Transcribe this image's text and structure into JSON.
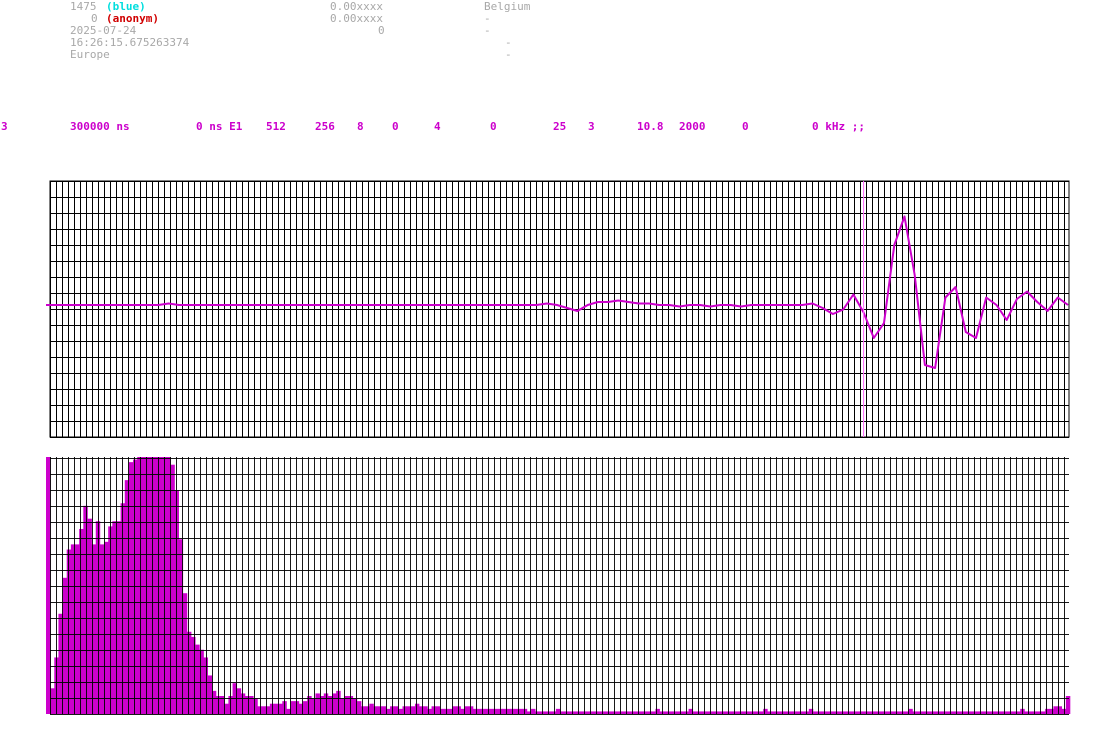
{
  "header": {
    "station_id": "1475",
    "station_color": "(blue)",
    "user_count": "0",
    "user_name": "(anonym)",
    "date": "2025-07-24",
    "time": "16:26:15.675263374",
    "region": "Europe",
    "coord_1": "0.00xxxx",
    "coord_2": "0.00xxxx",
    "value_3": "0",
    "country": "Belgium",
    "dash_1": "-",
    "dash_2": "-",
    "dash_3": "-",
    "dash_4": "-"
  },
  "params": [
    "3",
    "300000 ns",
    "0 ns E1",
    "512",
    "256",
    "8",
    "0",
    "4",
    "0",
    "25",
    "3",
    "10.8",
    "2000",
    "0",
    "0 kHz ;;"
  ],
  "colors": {
    "signal": "#cc00cc",
    "grid": "#000000",
    "marker": "#ff66ff"
  },
  "chart_data": [
    {
      "type": "line",
      "title": "",
      "xlabel": "",
      "ylabel": "",
      "x": [
        0,
        1,
        2,
        3,
        4,
        5,
        6,
        7,
        8,
        9,
        10,
        11,
        12,
        13,
        14,
        15,
        16,
        17,
        18,
        19,
        20,
        21,
        22,
        23,
        24,
        25,
        26,
        27,
        28,
        29,
        30,
        31,
        32,
        33,
        34,
        35,
        36,
        37,
        38,
        39,
        40,
        41,
        42,
        43,
        44,
        45,
        46,
        47,
        48,
        49,
        50,
        51,
        52,
        53,
        54,
        55,
        56,
        57,
        58,
        59,
        60,
        61,
        62,
        63,
        64,
        65,
        66,
        67,
        68,
        69,
        70,
        71,
        72,
        73,
        74,
        75,
        76,
        77,
        78,
        79,
        80,
        81,
        82,
        83,
        84,
        85,
        86,
        87,
        88,
        89,
        90,
        91,
        92,
        93,
        94,
        95,
        96,
        97,
        98,
        99,
        100
      ],
      "values": [
        0.0,
        0.0,
        0.0,
        0.0,
        0.0,
        0.0,
        0.0,
        0.0,
        0.0,
        0.0,
        0.0,
        0.0,
        0.01,
        0.0,
        0.0,
        0.0,
        0.0,
        0.0,
        0.0,
        0.0,
        0.0,
        0.0,
        0.0,
        0.0,
        0.0,
        0.0,
        0.0,
        0.0,
        0.0,
        0.0,
        0.0,
        0.0,
        0.0,
        0.0,
        0.0,
        0.0,
        0.0,
        0.0,
        0.0,
        0.0,
        0.0,
        0.0,
        0.0,
        0.0,
        0.0,
        0.0,
        0.0,
        0.0,
        0.0,
        0.01,
        0.0,
        -0.02,
        -0.04,
        0.0,
        0.02,
        0.02,
        0.03,
        0.02,
        0.01,
        0.01,
        0.0,
        0.0,
        -0.01,
        0.0,
        0.0,
        -0.01,
        0.0,
        0.0,
        -0.01,
        0.0,
        0.0,
        0.0,
        0.0,
        0.0,
        0.0,
        0.01,
        -0.02,
        -0.06,
        -0.03,
        0.07,
        -0.05,
        -0.22,
        -0.12,
        0.4,
        0.59,
        0.2,
        -0.4,
        -0.42,
        0.05,
        0.12,
        -0.18,
        -0.22,
        0.05,
        0.0,
        -0.1,
        0.04,
        0.09,
        0.02,
        -0.04,
        0.05,
        0.0
      ],
      "ylim": [
        -1,
        1
      ],
      "marker_x": 80
    },
    {
      "type": "bar",
      "title": "",
      "xlabel": "",
      "ylabel": "",
      "ylim": [
        0,
        100
      ],
      "values": [
        100,
        10,
        22,
        39,
        53,
        64,
        66,
        66,
        72,
        81,
        76,
        66,
        75,
        66,
        67,
        73,
        75,
        75,
        82,
        91,
        98,
        99,
        100,
        100,
        100,
        100,
        100,
        100,
        100,
        100,
        97,
        87,
        68,
        47,
        32,
        30,
        27,
        25,
        22,
        15,
        9,
        7,
        7,
        4,
        7,
        12,
        10,
        8,
        7,
        7,
        6,
        3,
        3,
        3,
        4,
        4,
        4,
        5,
        2,
        5,
        5,
        4,
        5,
        7,
        6,
        8,
        7,
        8,
        7,
        8,
        9,
        6,
        7,
        7,
        6,
        5,
        3,
        3,
        4,
        3,
        3,
        3,
        2,
        3,
        3,
        2,
        3,
        3,
        3,
        4,
        3,
        3,
        2,
        3,
        3,
        2,
        2,
        2,
        3,
        3,
        2,
        3,
        3,
        2,
        2,
        2,
        2,
        2,
        2,
        2,
        2,
        2,
        2,
        2,
        2,
        2,
        1,
        2,
        1,
        1,
        1,
        1,
        1,
        2,
        1,
        1,
        1,
        1,
        1,
        1,
        1,
        1,
        1,
        1,
        1,
        1,
        1,
        1,
        1,
        1,
        1,
        1,
        1,
        1,
        1,
        1,
        1,
        2,
        1,
        1,
        1,
        1,
        1,
        1,
        1,
        2,
        1,
        1,
        1,
        1,
        1,
        1,
        1,
        1,
        1,
        1,
        1,
        1,
        1,
        1,
        1,
        1,
        1,
        2,
        1,
        1,
        1,
        1,
        1,
        1,
        1,
        1,
        1,
        1,
        2,
        1,
        1,
        1,
        1,
        1,
        1,
        1,
        1,
        1,
        1,
        1,
        1,
        1,
        1,
        1,
        1,
        1,
        1,
        1,
        1,
        1,
        1,
        1,
        2,
        1,
        1,
        1,
        1,
        1,
        1,
        1,
        1,
        1,
        1,
        1,
        1,
        1,
        1,
        1,
        1,
        1,
        1,
        1,
        1,
        1,
        1,
        1,
        1,
        1,
        1,
        2,
        1,
        1,
        1,
        1,
        1,
        2,
        2,
        3,
        3,
        2,
        7
      ]
    }
  ]
}
